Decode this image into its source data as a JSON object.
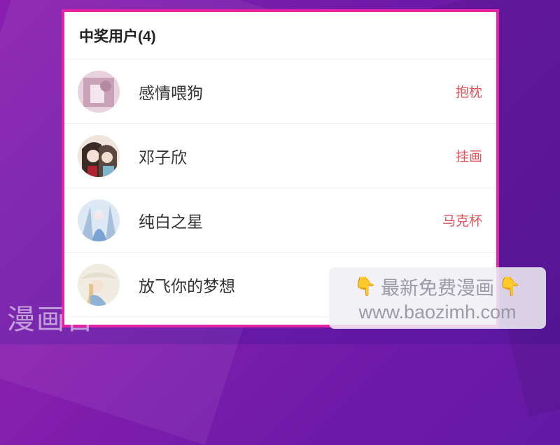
{
  "panel": {
    "title": "中奖用户(4)"
  },
  "winners": [
    {
      "name": "感情喂狗",
      "prize": "抱枕"
    },
    {
      "name": "邓子欣",
      "prize": "挂画"
    },
    {
      "name": "纯白之星",
      "prize": "马克杯"
    },
    {
      "name": "放飞你的梦想",
      "prize": ""
    }
  ],
  "watermark": {
    "site_name": "漫画台",
    "overlay_text": "最新免费漫画",
    "overlay_url": "www.baozimh.com",
    "hand_icon": "👇"
  },
  "colors": {
    "border": "#e323a4",
    "prize_text": "#e0555b",
    "background": "#6e1aa8"
  }
}
